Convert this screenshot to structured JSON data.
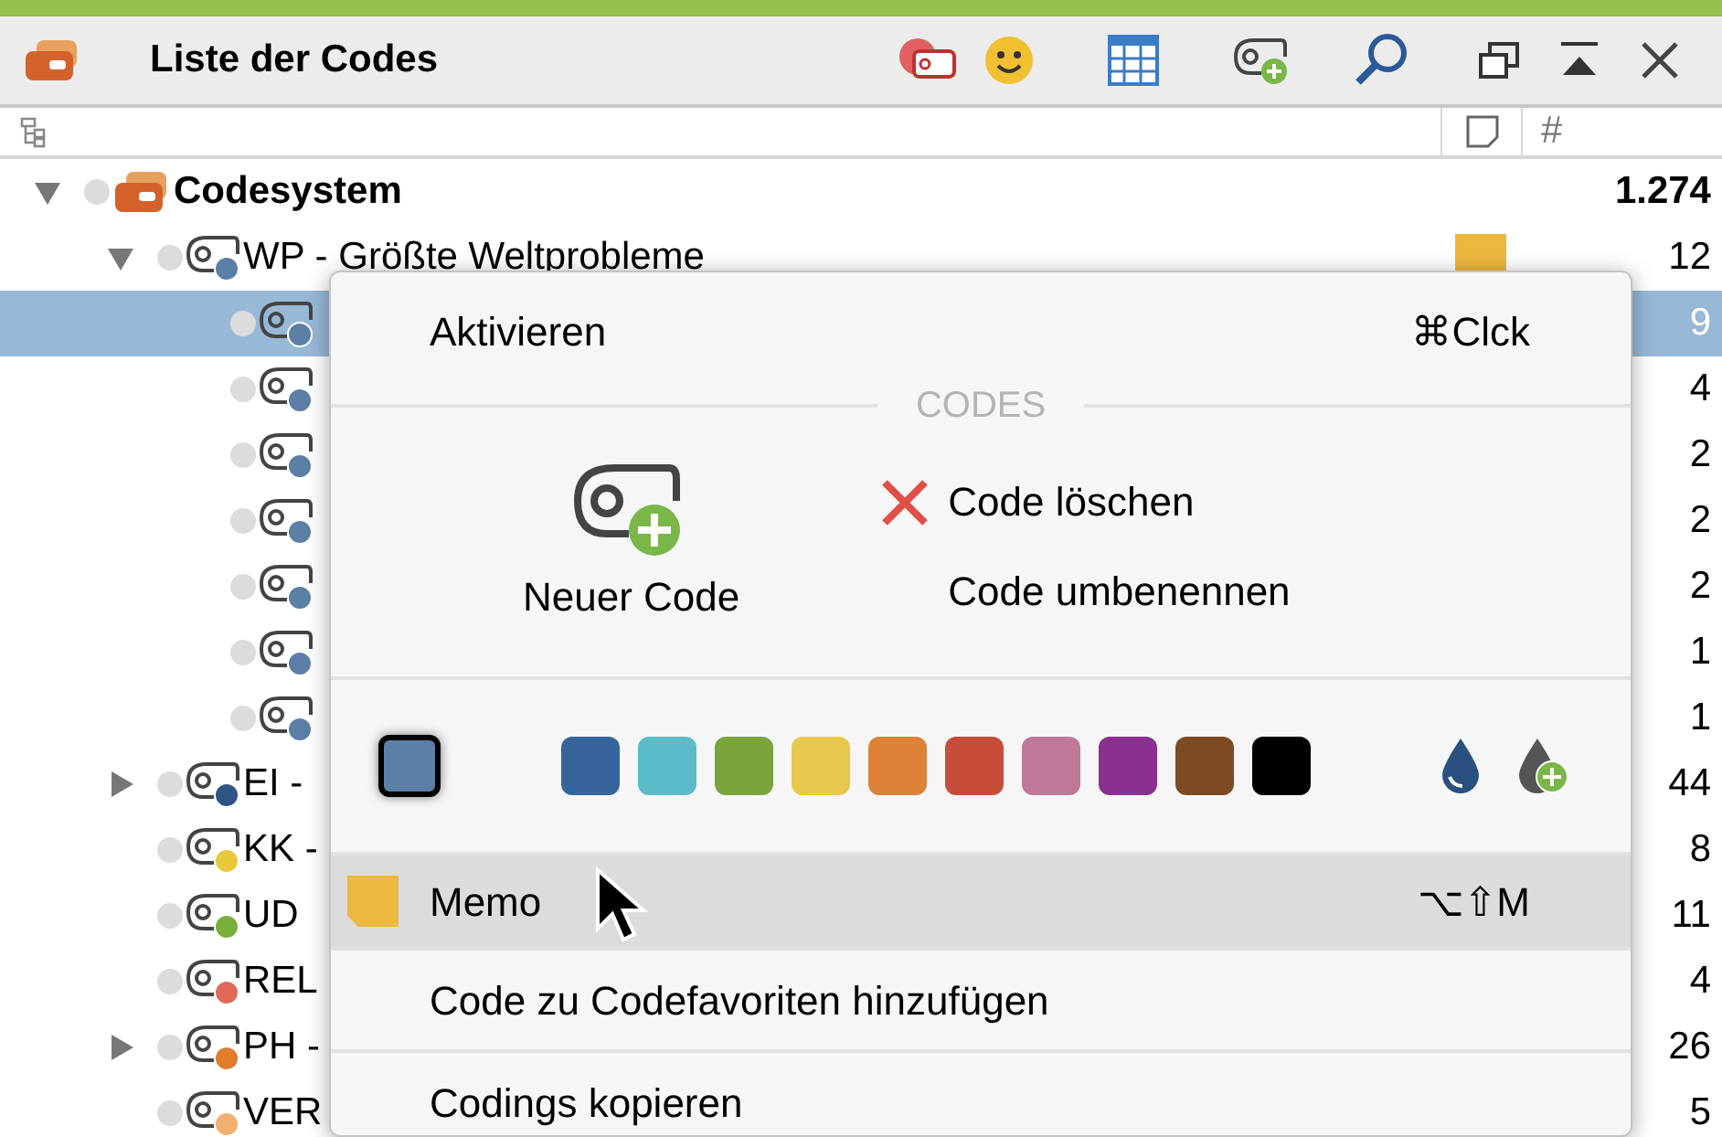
{
  "panel": {
    "title": "Liste der Codes"
  },
  "column_header": {
    "count_label": "#"
  },
  "tree": [
    {
      "label": "Codesystem",
      "count": "1.274",
      "expanded": true,
      "selected": false,
      "kind": "root",
      "children": [
        {
          "label": "WP - Größte Weltprobleme",
          "count": "12",
          "color": "#5b7fa6",
          "expanded": true,
          "memo": true,
          "selected": false,
          "children": [
            {
              "count": "9",
              "color": "#5b7fa6",
              "selected": true
            },
            {
              "count": "4",
              "color": "#5b7fa6",
              "selected": false
            },
            {
              "count": "2",
              "color": "#5b7fa6",
              "selected": false
            },
            {
              "count": "2",
              "color": "#5b7fa6",
              "selected": false
            },
            {
              "count": "2",
              "color": "#5b7fa6",
              "selected": false
            },
            {
              "count": "1",
              "color": "#5b7fa6",
              "selected": false
            },
            {
              "count": "1",
              "color": "#5b7fa6",
              "selected": false
            }
          ]
        },
        {
          "label": "EI -",
          "count": "44",
          "color": "#2e5586",
          "expanded": false,
          "selected": false
        },
        {
          "label": "KK -",
          "count": "8",
          "color": "#e8c93c",
          "selected": false
        },
        {
          "label": "UD",
          "count": "11",
          "color": "#7aaf3c",
          "selected": false
        },
        {
          "label": "REL",
          "count": "4",
          "color": "#e06a5a",
          "selected": false
        },
        {
          "label": "PH -",
          "count": "26",
          "color": "#e07c2c",
          "expanded": false,
          "selected": false
        },
        {
          "label": "VER",
          "count": "5",
          "color": "#f0b070",
          "selected": false
        }
      ]
    }
  ],
  "context_menu": {
    "top_item": {
      "label": "Aktivieren",
      "shortcut": "⌘Clck",
      "selected": false
    },
    "section_header": "CODES",
    "new_code": "Neuer Code",
    "actions": [
      {
        "label": "Code löschen",
        "kind": "delete"
      },
      {
        "label": "Code umbenennen",
        "kind": "plain"
      }
    ],
    "current_swatch": {
      "color": "#5b7fa6"
    },
    "palette": [
      {
        "color": "#35659c"
      },
      {
        "color": "#5bbcc8"
      },
      {
        "color": "#7aa53c"
      },
      {
        "color": "#e8c84a"
      },
      {
        "color": "#dd8236"
      },
      {
        "color": "#c84c3a"
      },
      {
        "color": "#c07898"
      },
      {
        "color": "#8a3090"
      },
      {
        "color": "#7e4a22"
      },
      {
        "color": "#000000"
      }
    ],
    "items": [
      {
        "label": "Memo",
        "shortcut": "⌥⇧M",
        "kind": "memo",
        "selected": true
      },
      {
        "label": "Code zu Codefavoriten hinzufügen",
        "kind": "plain",
        "selected": false
      },
      {
        "label": "Codings kopieren",
        "kind": "plain",
        "selected": false
      }
    ]
  }
}
